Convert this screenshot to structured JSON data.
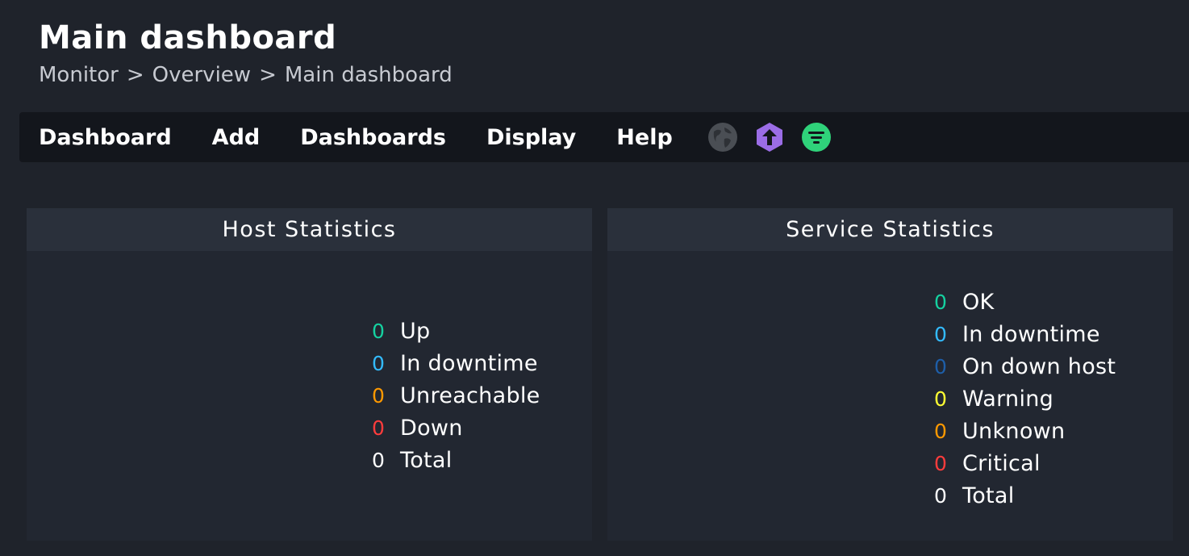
{
  "header": {
    "title": "Main dashboard",
    "breadcrumb": [
      "Monitor",
      ">",
      "Overview",
      ">",
      "Main dashboard"
    ]
  },
  "menu": {
    "items": [
      "Dashboard",
      "Add",
      "Dashboards",
      "Display",
      "Help"
    ],
    "icons": [
      {
        "name": "globe-icon",
        "color": "#555a60"
      },
      {
        "name": "upgrade-arrow-icon",
        "color": "#9b6de6"
      },
      {
        "name": "filter-icon",
        "color": "#2fd27a"
      }
    ]
  },
  "host_statistics": {
    "title": "Host Statistics",
    "rows": [
      {
        "count": "0",
        "label": "Up",
        "color": "#15d1a0"
      },
      {
        "count": "0",
        "label": "In downtime",
        "color": "#33bbff"
      },
      {
        "count": "0",
        "label": "Unreachable",
        "color": "#ff9900"
      },
      {
        "count": "0",
        "label": "Down",
        "color": "#ff3c3c"
      },
      {
        "count": "0",
        "label": "Total",
        "color": "#ffffff"
      }
    ]
  },
  "service_statistics": {
    "title": "Service Statistics",
    "rows": [
      {
        "count": "0",
        "label": "OK",
        "color": "#15d1a0"
      },
      {
        "count": "0",
        "label": "In downtime",
        "color": "#33bbff"
      },
      {
        "count": "0",
        "label": "On down host",
        "color": "#1e5ea8"
      },
      {
        "count": "0",
        "label": "Warning",
        "color": "#ffff33"
      },
      {
        "count": "0",
        "label": "Unknown",
        "color": "#ff9900"
      },
      {
        "count": "0",
        "label": "Critical",
        "color": "#ff3c3c"
      },
      {
        "count": "0",
        "label": "Total",
        "color": "#ffffff"
      }
    ]
  }
}
